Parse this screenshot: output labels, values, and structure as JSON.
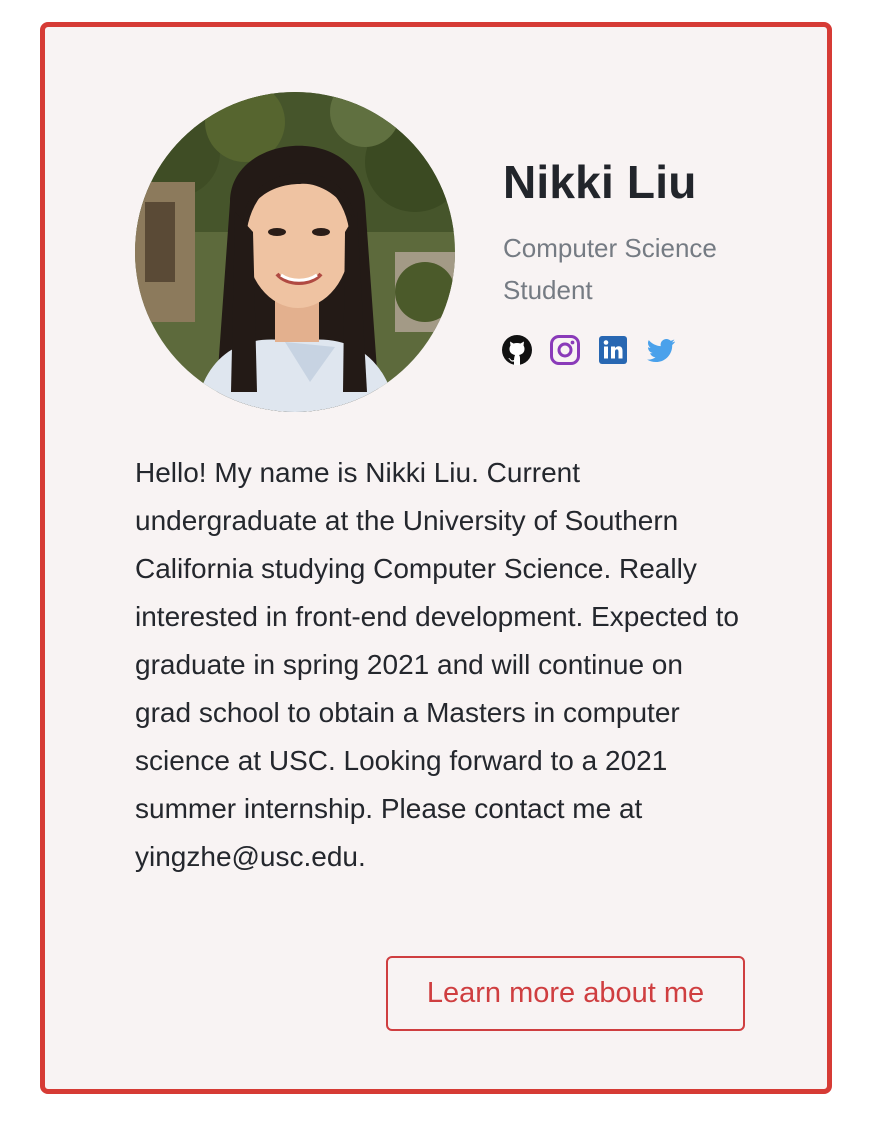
{
  "profile": {
    "name": "Nikki Liu",
    "subtitle": "Computer Science Student",
    "bio": "Hello! My name is Nikki Liu. Current undergraduate at the University of Southern California studying Computer Science. Really interested in front-end development. Expected to graduate in spring 2021 and will continue on grad school to obtain a Masters in computer science at USC. Looking forward to a 2021 summer internship. Please contact me at yingzhe@usc.edu.",
    "button_label": "Learn more about me"
  },
  "socials": [
    {
      "icon": "github-icon",
      "color": "#111111"
    },
    {
      "icon": "instagram-icon",
      "color": "#8a3ab9"
    },
    {
      "icon": "linkedin-icon",
      "color": "#2867b2"
    },
    {
      "icon": "twitter-icon",
      "color": "#4aa1eb"
    }
  ],
  "colors": {
    "accent": "#d63b35",
    "card_background": "#f8f3f3",
    "heading": "#22252b",
    "muted": "#757b83"
  }
}
